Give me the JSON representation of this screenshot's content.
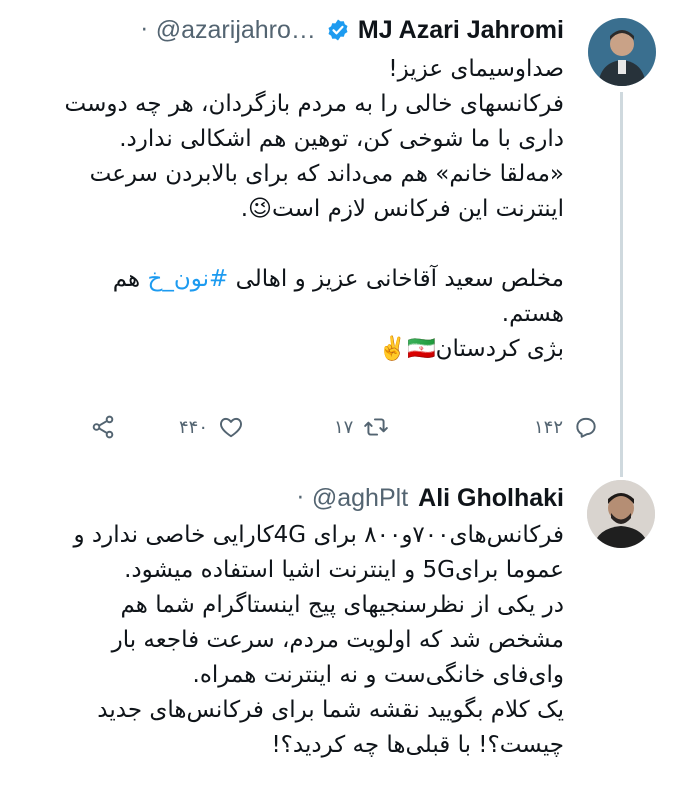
{
  "tweet1": {
    "name": "MJ Azari Jahromi",
    "handle": "@azarijahro…",
    "dot": "·",
    "lines": [
      "صداوسیمای عزیز!",
      "فرکانسهای خالی را به مردم بازگردان، هر چه دوست",
      "داری با ما شوخی کن، توهین هم اشکالی ندارد.",
      "«مه‌لقا خانم» هم می‌داند که برای بالابردن سرعت",
      "اینترنت این فرکانس لازم است😉.",
      "",
      "مخلص سعید آقاخانی عزیز و اهالی",
      "#نون_خ",
      "هم",
      "هستم.",
      "بژی کردستان🇮🇷✌️"
    ],
    "actions": {
      "reply_count": "۱۴۲",
      "retweet_count": "۱۷",
      "like_count": "۴۴۰"
    },
    "icons": {
      "verified": "verified-badge-icon",
      "reply": "reply-icon",
      "retweet": "retweet-icon",
      "like": "heart-icon",
      "share": "share-icon"
    }
  },
  "tweet2": {
    "name": "Ali Gholhaki",
    "handle": "@aghPlt",
    "dot": "·",
    "lines": [
      "فرکانس‌های۷۰۰و۸۰۰ برای 4Gکارایی خاصی ندارد و",
      "عموما برای5G و اینترنت اشیا استفاده میشود.",
      "در یکی از نظرسنجیهای پیج اینستاگرام شما هم",
      "مشخص شد که اولویت مردم، سرعت فاجعه بار",
      "وای‌فای خانگی‌ست و نه اینترنت همراه.",
      "یک کلام بگویید نقشه شما برای فرکانس‌های جدید",
      "چیست؟! با قبلی‌ها چه کردید؟!"
    ]
  },
  "colors": {
    "accent": "#1d9bf0",
    "text": "#0f1419",
    "secondary": "#536471",
    "thread_line": "#cfd9de"
  }
}
